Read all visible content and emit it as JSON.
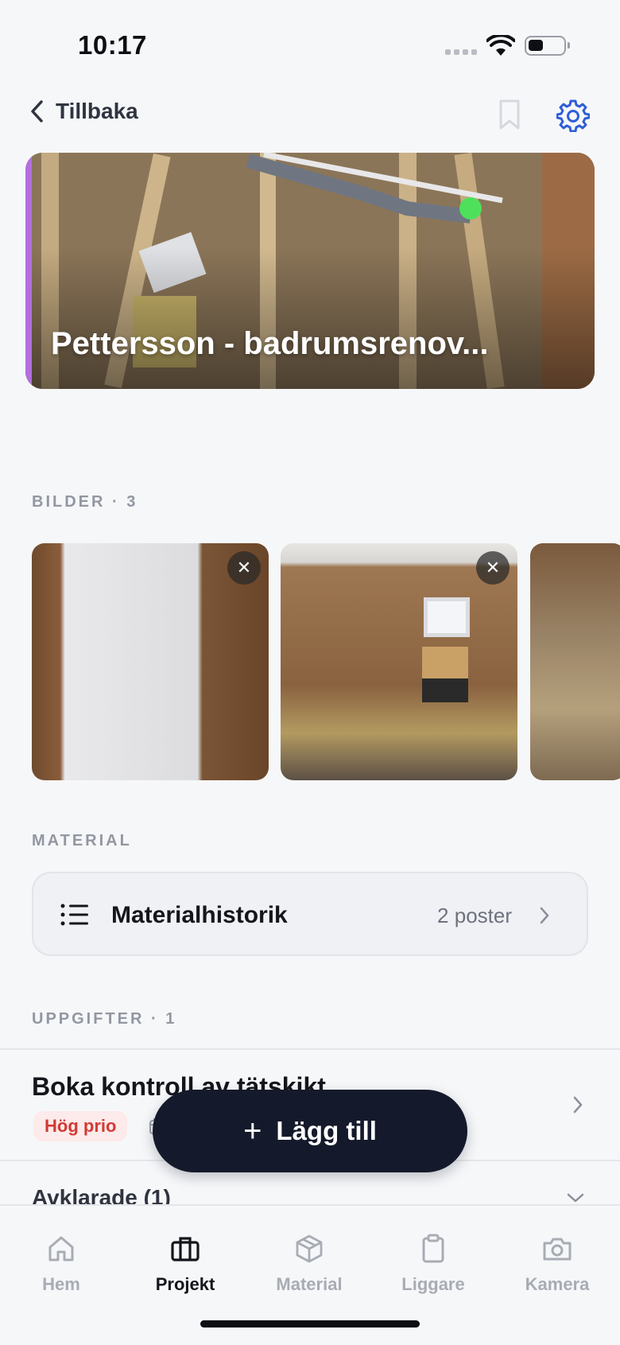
{
  "status_bar": {
    "time": "10:17"
  },
  "nav": {
    "back_label": "Tillbaka"
  },
  "project": {
    "title": "Pettersson - badrumsrenov..."
  },
  "images_section": {
    "label": "BILDER · 3"
  },
  "material_section": {
    "label": "MATERIAL",
    "card_title": "Materialhistorik",
    "card_count": "2 poster"
  },
  "tasks_section": {
    "label": "UPPGIFTER · 1",
    "tasks": [
      {
        "title": "Boka kontroll av tätskikt",
        "priority": "Hög prio"
      }
    ],
    "completed_label": "Avklarade (1)"
  },
  "fab": {
    "label": "Lägg till"
  },
  "tabbar": {
    "items": [
      {
        "label": "Hem",
        "icon": "home-icon"
      },
      {
        "label": "Projekt",
        "icon": "briefcase-icon",
        "active": true
      },
      {
        "label": "Material",
        "icon": "box-icon"
      },
      {
        "label": "Liggare",
        "icon": "clipboard-icon"
      },
      {
        "label": "Kamera",
        "icon": "camera-icon"
      }
    ]
  },
  "colors": {
    "accent": "#2f5fd7",
    "priority_high": "#d23a35",
    "fab": "#141a2b",
    "hero_accent": "#b36ee0"
  }
}
